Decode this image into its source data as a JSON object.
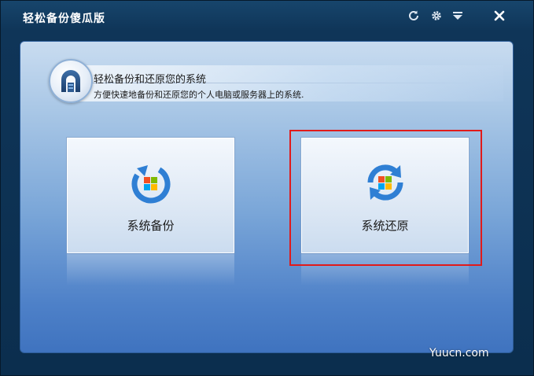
{
  "app": {
    "title": "轻松备份傻瓜版"
  },
  "titlebar_controls": [
    {
      "name": "refresh-icon"
    },
    {
      "name": "gear-icon"
    },
    {
      "name": "menu-icon"
    },
    {
      "name": "close-icon"
    }
  ],
  "header": {
    "title": "轻松备份和还原您的系统",
    "subtitle": "方便快速地备份和还原您的个人电脑或服务器上的系统."
  },
  "tiles": [
    {
      "label": "系统备份",
      "icon": "backup-icon"
    },
    {
      "label": "系统还原",
      "icon": "restore-icon"
    }
  ],
  "colors": {
    "highlight": "#e11a1a",
    "accent_blue": "#2f7fd4"
  },
  "watermark": "Yuucn.com"
}
